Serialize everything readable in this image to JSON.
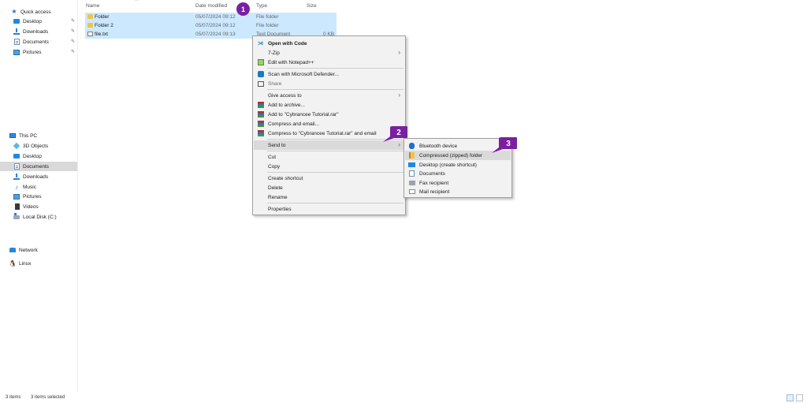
{
  "sidebar": {
    "quick_access": "Quick access",
    "quick_items": [
      {
        "label": "Desktop",
        "icon": "desktop-icon"
      },
      {
        "label": "Downloads",
        "icon": "downloads-icon"
      },
      {
        "label": "Documents",
        "icon": "documents-icon"
      },
      {
        "label": "Pictures",
        "icon": "pictures-icon"
      }
    ],
    "this_pc": "This PC",
    "pc_items": [
      {
        "label": "3D Objects"
      },
      {
        "label": "Desktop"
      },
      {
        "label": "Documents",
        "selected": true
      },
      {
        "label": "Downloads"
      },
      {
        "label": "Music"
      },
      {
        "label": "Pictures"
      },
      {
        "label": "Videos"
      },
      {
        "label": "Local Disk (C:)"
      }
    ],
    "network": "Network",
    "linux": "Linux"
  },
  "columns": {
    "name": "Name",
    "date": "Date modified",
    "type": "Type",
    "size": "Size"
  },
  "files": [
    {
      "name": "Folder",
      "date": "05/07/2024 09:12",
      "type": "File folder",
      "size": ""
    },
    {
      "name": "Folder 2",
      "date": "05/07/2024 09:12",
      "type": "File folder",
      "size": ""
    },
    {
      "name": "file.txt",
      "date": "05/07/2024 09:13",
      "type": "Text Document",
      "size": "0 KB"
    }
  ],
  "context_menu": {
    "open_with_code": "Open with Code",
    "seven_zip": "7-Zip",
    "edit_notepad": "Edit with Notepad++",
    "scan_defender": "Scan with Microsoft Defender...",
    "share": "Share",
    "give_access": "Give access to",
    "add_archive": "Add to archive...",
    "add_rar": "Add to \"Cybrancee Tutorial.rar\"",
    "compress_email": "Compress and email...",
    "compress_rar_email": "Compress to \"Cybrancee Tutorial.rar\" and email",
    "send_to": "Send to",
    "cut": "Cut",
    "copy": "Copy",
    "create_shortcut": "Create shortcut",
    "delete": "Delete",
    "rename": "Rename",
    "properties": "Properties"
  },
  "send_to_menu": {
    "bluetooth": "Bluetooth device",
    "compressed": "Compressed (zipped) folder",
    "desktop_shortcut": "Desktop (create shortcut)",
    "documents": "Documents",
    "fax": "Fax recipient",
    "mail": "Mail recipient"
  },
  "badges": {
    "one": "1",
    "two": "2",
    "three": "3"
  },
  "colors": {
    "badge": "#7a1fa2",
    "selection": "#cce8ff",
    "accent": "#1e88e5"
  },
  "status": {
    "items": "3 items",
    "selected": "3 items selected"
  }
}
